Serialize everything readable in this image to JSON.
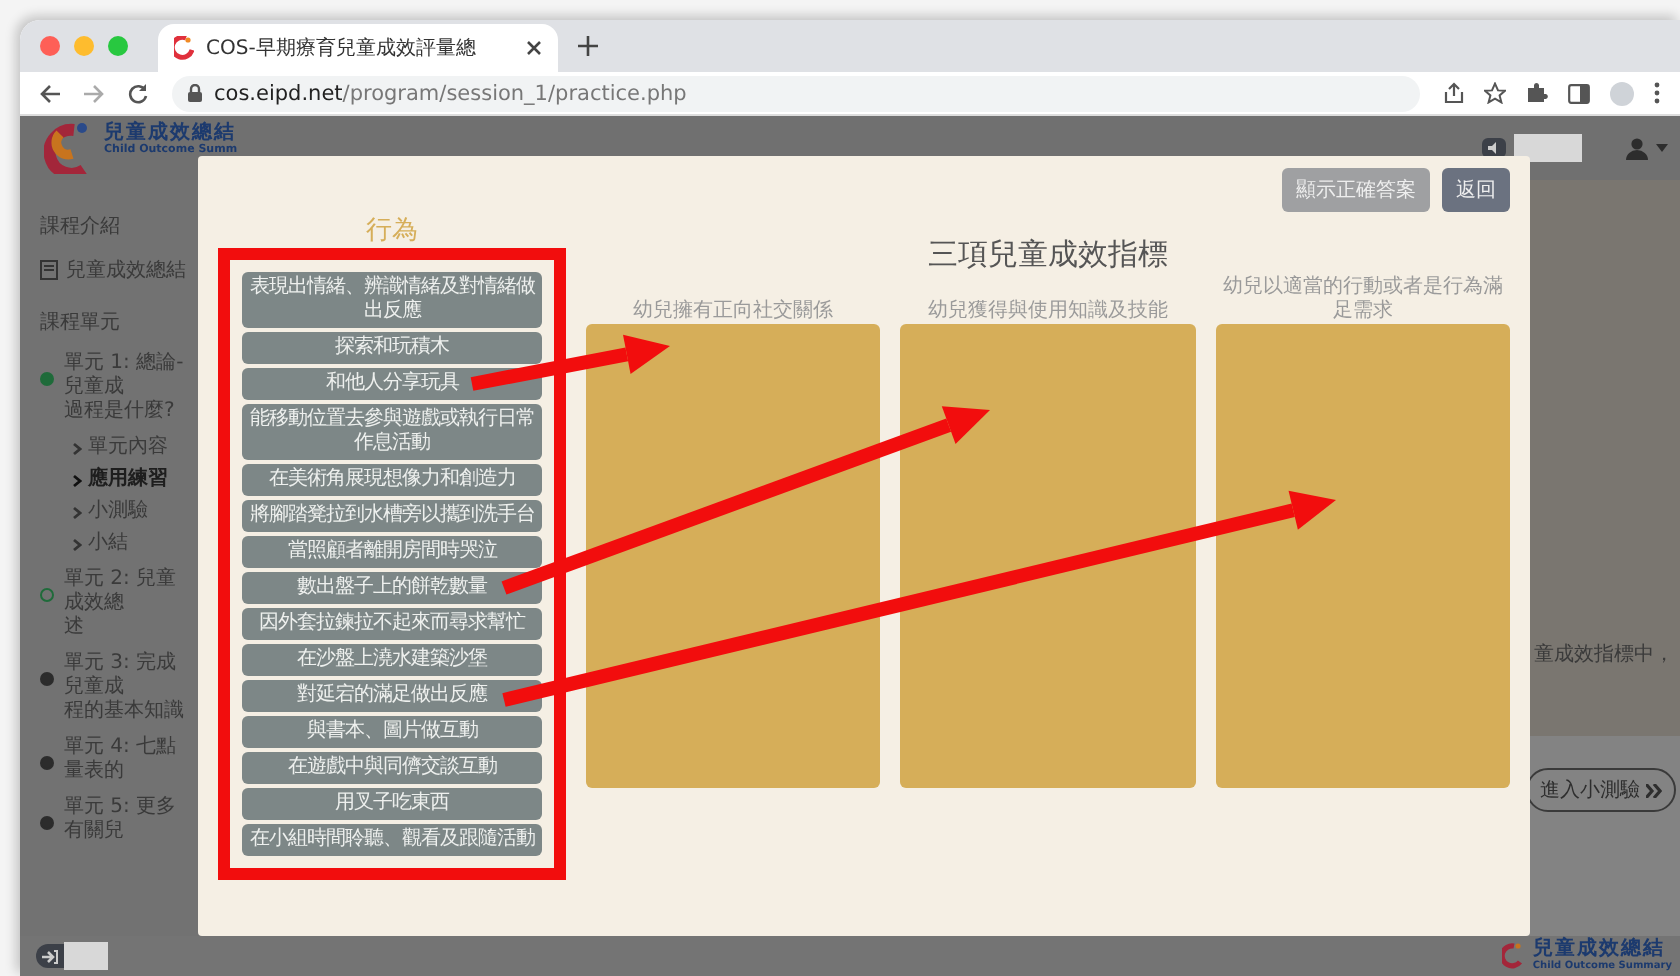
{
  "browser": {
    "tab_title": "COS-早期療育兒童成效評量總",
    "url_host": "cos.eipd.net",
    "url_path": "/program/session_1/practice.php"
  },
  "header": {
    "logo_title": "兒童成效總結",
    "logo_subtitle": "Child Outcome Summ"
  },
  "sidebar": {
    "intro_heading": "課程介紹",
    "intro_link": "兒童成效總結",
    "units_heading": "課程單元",
    "units": [
      {
        "title": "單元 1: 總論-兒童成",
        "title_cont": "過程是什麼?",
        "started": true,
        "completed": true,
        "children": [
          {
            "label": "單元內容",
            "selected": false
          },
          {
            "label": "應用練習",
            "selected": true
          },
          {
            "label": "小測驗",
            "selected": false
          },
          {
            "label": "小結",
            "selected": false
          }
        ]
      },
      {
        "title": "單元 2: 兒童成效總",
        "title_cont": "述",
        "started": true,
        "completed": false
      },
      {
        "title": "單元 3: 完成兒童成",
        "title_cont": "程的基本知識",
        "started": false,
        "completed": false
      },
      {
        "title": "單元 4: 七點量表的",
        "started": false,
        "completed": false
      },
      {
        "title": "單元 5: 更多有關兒",
        "started": false,
        "completed": false
      }
    ]
  },
  "main": {
    "text_fragment": "童成效指標中，",
    "quiz_button": "進入小測驗"
  },
  "footer": {
    "logo_title": "兒童成效總結",
    "logo_subtitle": "Child Outcome Summary"
  },
  "modal": {
    "buttons": [
      {
        "label": "顯示正確答案",
        "kind": "secondary"
      },
      {
        "label": "返回",
        "kind": "primary"
      }
    ],
    "behaviors_heading": "行為",
    "behaviors": [
      "表現出情緒、辨識情緒及對情緒做出反應",
      "探索和玩積木",
      "和他人分享玩具",
      "能移動位置去參與遊戲或執行日常作息活動",
      "在美術角展現想像力和創造力",
      "將腳踏凳拉到水槽旁以攜到洗手台",
      "當照顧者離開房間時哭泣",
      "數出盤子上的餅乾數量",
      "因外套拉鍊拉不起來而尋求幫忙",
      "在沙盤上澆水建築沙堡",
      "對延宕的滿足做出反應",
      "與書本、圖片做互動",
      "在遊戲中與同儕交談互動",
      "用叉子吃東西",
      "在小組時間聆聽、觀看及跟隨活動"
    ],
    "outcomes_title": "三項兒童成效指標",
    "outcomes": [
      "幼兒擁有正向社交關係",
      "幼兒獲得與使用知識及技能",
      "幼兒以適當的行動或者是行為滿足需求"
    ]
  }
}
